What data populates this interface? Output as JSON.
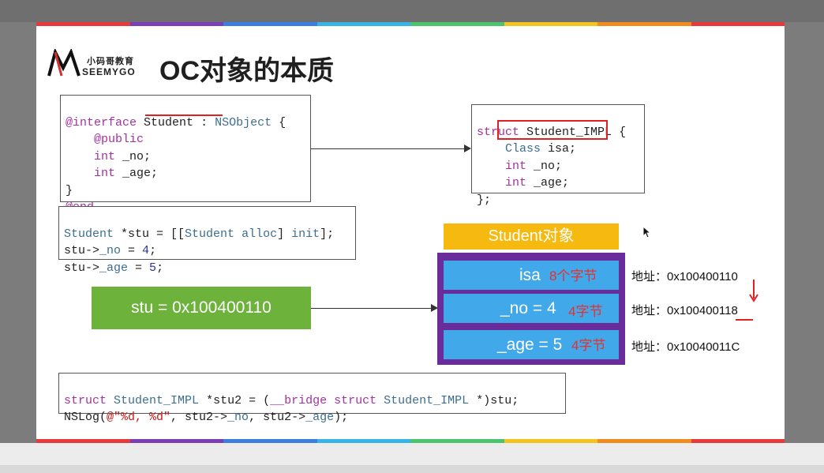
{
  "slide": {
    "title": "OC对象的本质",
    "logo": {
      "cn": "小码哥教育",
      "en": "SEEMYGO"
    }
  },
  "interface_code": {
    "lines": [
      [
        "@interface",
        "Student",
        ":",
        "NSObject",
        "{"
      ],
      [
        "@public"
      ],
      [
        "int",
        "_no;"
      ],
      [
        "int",
        "_age;"
      ],
      [
        "}"
      ],
      [
        "@end"
      ]
    ]
  },
  "struct_code": {
    "l1": [
      "struct",
      "Student_IMPL",
      "{"
    ],
    "l2": [
      "Class",
      "isa;"
    ],
    "l3": [
      "int",
      "_no;"
    ],
    "l4": [
      "int",
      "_age;"
    ],
    "l5": "};"
  },
  "alloc_code": {
    "l1": [
      "Student",
      "*stu = [[",
      "Student",
      "alloc",
      "]",
      "init",
      "];"
    ],
    "l2": [
      "stu->",
      "_no",
      " = ",
      "4",
      ";"
    ],
    "l3": [
      "stu->",
      "_age",
      " = ",
      "5",
      ";"
    ]
  },
  "bridge_code": {
    "l1": [
      "struct",
      "Student_IMPL",
      "*stu2 = (",
      "__bridge",
      "struct",
      "Student_IMPL",
      "*)stu;"
    ],
    "l2": [
      "NSLog(",
      "@\"%d, %d\"",
      ", stu2->",
      "_no",
      ", stu2->",
      "_age",
      ");"
    ]
  },
  "diagram": {
    "object_label": "Student对象",
    "pointer_label": "stu = 0x100400110",
    "cells": [
      {
        "field": "isa",
        "size": "8个字节",
        "address": "地址：0x100400110"
      },
      {
        "field": "_no = 4",
        "size": "4字节",
        "address": "地址：0x100400118"
      },
      {
        "field": "_age = 5",
        "size": "4字节",
        "address": "地址：0x10040011C"
      }
    ]
  },
  "colors": {
    "stripe": [
      "#e73b3b",
      "#7b3fb5",
      "#3b7de0",
      "#36b4e5",
      "#4cc46b",
      "#f2c41d",
      "#f28a1d",
      "#e73b3b"
    ],
    "green": "#6db23b",
    "purple": "#6a2b9b",
    "blue": "#41a9e9",
    "orange": "#f5b90f",
    "red": "#e02020"
  }
}
